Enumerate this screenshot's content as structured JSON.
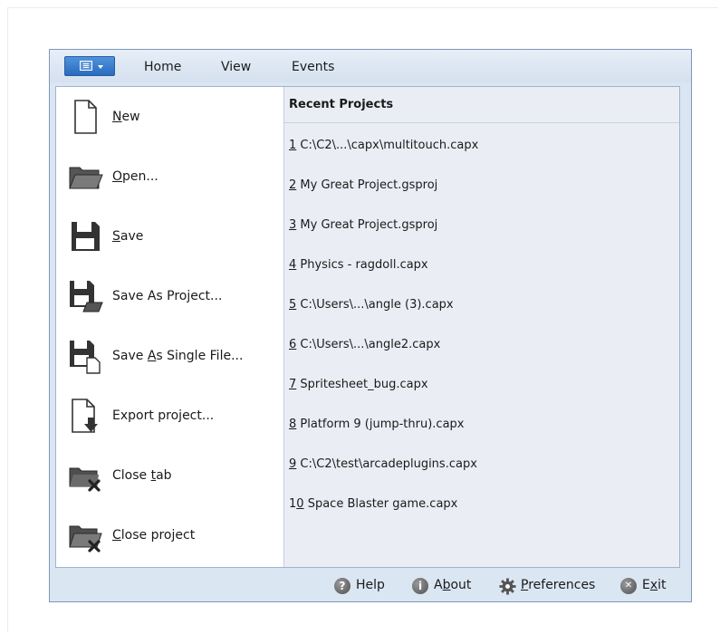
{
  "ribbon": {
    "tabs": [
      {
        "label": "Home"
      },
      {
        "label": "View"
      },
      {
        "label": "Events"
      }
    ]
  },
  "menu": {
    "commands": [
      {
        "pre": "",
        "u": "N",
        "post": "ew",
        "icon": "new-file-icon"
      },
      {
        "pre": "",
        "u": "O",
        "post": "pen...",
        "icon": "open-folder-icon"
      },
      {
        "pre": "",
        "u": "S",
        "post": "ave",
        "icon": "save-disk-icon"
      },
      {
        "pre": "Save As Pro",
        "u": "j",
        "post": "ect...",
        "icon": "save-as-project-icon"
      },
      {
        "pre": "Save ",
        "u": "A",
        "post": "s Single File...",
        "icon": "save-as-single-file-icon"
      },
      {
        "pre": "Export project...",
        "u": "",
        "post": "",
        "icon": "export-project-icon"
      },
      {
        "pre": "Close ",
        "u": "t",
        "post": "ab",
        "icon": "close-tab-icon"
      },
      {
        "pre": "",
        "u": "C",
        "post": "lose project",
        "icon": "close-project-icon"
      }
    ]
  },
  "recent": {
    "title": "Recent Projects",
    "items": [
      {
        "num": "1",
        "name": " C:\\C2\\...\\capx\\multitouch.capx"
      },
      {
        "num": "2",
        "name": " My Great Project.gsproj"
      },
      {
        "num": "3",
        "name": " My Great Project.gsproj"
      },
      {
        "num": "4",
        "name": " Physics - ragdoll.capx"
      },
      {
        "num": "5",
        "name": " C:\\Users\\...\\angle (3).capx"
      },
      {
        "num": "6",
        "name": " C:\\Users\\...\\angle2.capx"
      },
      {
        "num": "7",
        "name": " Spritesheet_bug.capx"
      },
      {
        "num": "8",
        "name": " Platform 9 (jump-thru).capx"
      },
      {
        "num": "9",
        "name": " C:\\C2\\test\\arcadeplugins.capx"
      },
      {
        "num": "1",
        "num_u": "0",
        "name": " Space Blaster game.capx"
      }
    ]
  },
  "footer": {
    "help": {
      "pre": "Help",
      "u": "",
      "post": "",
      "icon": "help-icon",
      "glyph": "?"
    },
    "about": {
      "pre": "A",
      "u": "b",
      "post": "out",
      "icon": "info-icon",
      "glyph": "i"
    },
    "preferences": {
      "pre": "",
      "u": "P",
      "post": "references",
      "icon": "gear-icon"
    },
    "exit": {
      "pre": "E",
      "u": "x",
      "post": "it",
      "icon": "close-icon",
      "glyph": "✕"
    }
  }
}
